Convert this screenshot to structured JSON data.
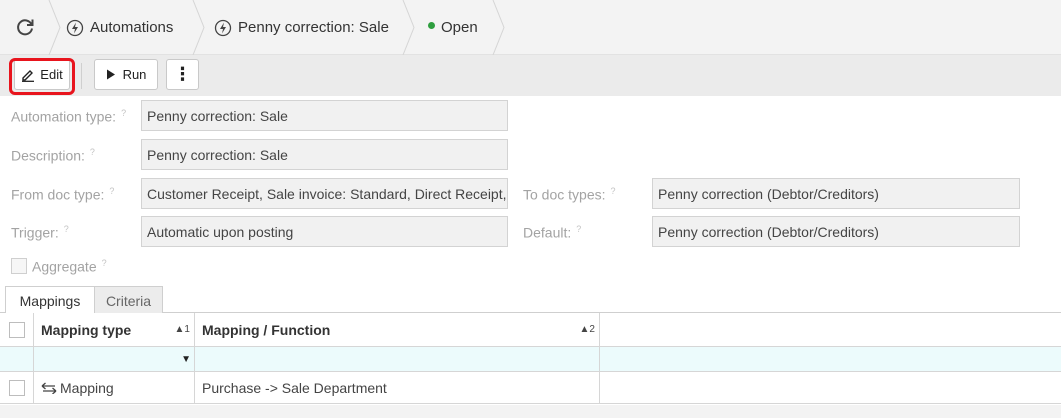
{
  "breadcrumb": {
    "items": [
      {
        "label": "Automations"
      },
      {
        "label": "Penny correction: Sale"
      },
      {
        "label": "Open"
      }
    ],
    "status_color": "#2e9e3f"
  },
  "toolbar": {
    "edit_label": "Edit",
    "run_label": "Run",
    "more_label": "⋮"
  },
  "form": {
    "automation_type_label": "Automation type:",
    "automation_type_value": "Penny correction: Sale",
    "description_label": "Description:",
    "description_value": "Penny correction: Sale",
    "from_doc_type_label": "From doc type:",
    "from_doc_type_value": "Customer Receipt, Sale invoice: Standard, Direct Receipt, Re",
    "to_doc_types_label": "To doc types:",
    "to_doc_types_value": "Penny correction (Debtor/Creditors)",
    "trigger_label": "Trigger:",
    "trigger_value": "Automatic upon posting",
    "default_label": "Default:",
    "default_value": "Penny correction (Debtor/Creditors)",
    "aggregate_label": "Aggregate",
    "help_mark": "?"
  },
  "tabs": [
    {
      "label": "Mappings"
    },
    {
      "label": "Criteria"
    }
  ],
  "grid": {
    "columns": [
      {
        "label": "Mapping type",
        "sort": "▲1"
      },
      {
        "label": "Mapping / Function",
        "sort": "▲2"
      }
    ],
    "filter_dropdown": "▼",
    "rows": [
      {
        "mapping_type": "Mapping",
        "mapping_function": "Purchase -> Sale Department"
      }
    ]
  },
  "colors": {
    "highlight": "#e8141d",
    "filter_row_bg": "#ecfbfc"
  }
}
